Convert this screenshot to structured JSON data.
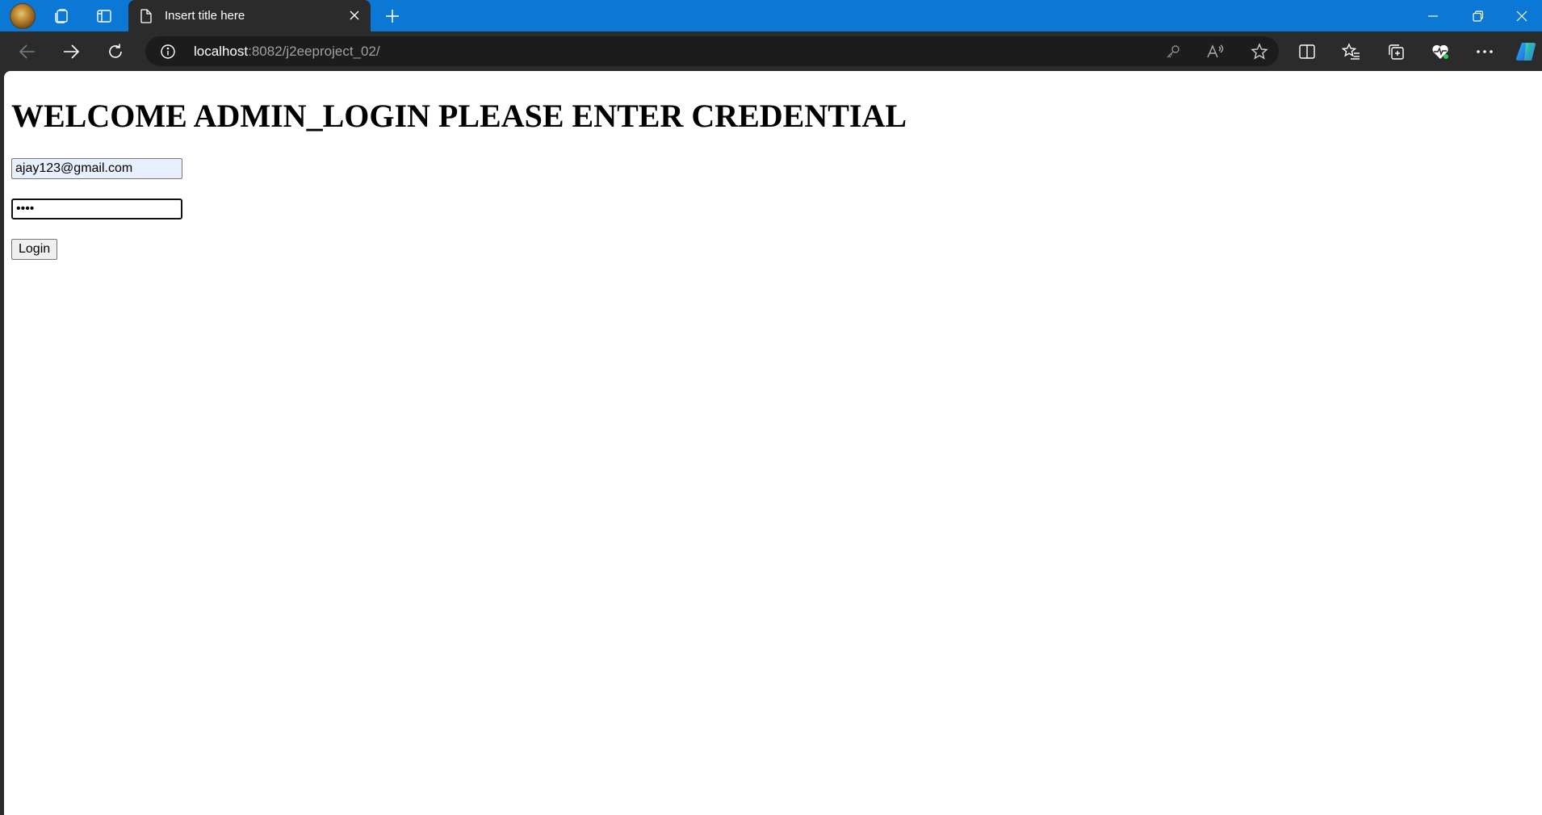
{
  "browser": {
    "tab_title": "Insert title here",
    "url_host": "localhost",
    "url_path": ":8082/j2eeproject_02/",
    "accent_color": "#0a78d4",
    "chrome_color": "#2b2b2b"
  },
  "page": {
    "heading": "WELCOME ADMIN_LOGIN PLEASE ENTER CREDENTIAL",
    "email_value": "ajay123@gmail.com",
    "password_value": "••••",
    "login_label": "Login"
  }
}
